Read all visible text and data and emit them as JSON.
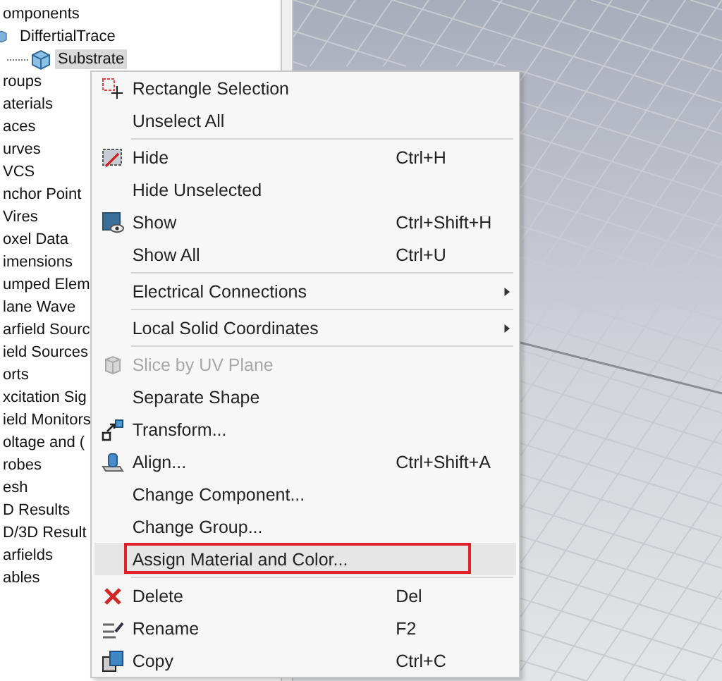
{
  "tree": [
    {
      "label": "omponents",
      "selected": false,
      "children": [
        {
          "label": "DiffertialTrace",
          "selected": false,
          "children": [
            {
              "label": "Substrate",
              "selected": true
            }
          ]
        }
      ]
    },
    {
      "label": "roups",
      "selected": false
    },
    {
      "label": "aterials",
      "selected": false
    },
    {
      "label": "aces",
      "selected": false
    },
    {
      "label": "urves",
      "selected": false
    },
    {
      "label": "VCS",
      "selected": false
    },
    {
      "label": "nchor Point",
      "selected": false
    },
    {
      "label": "Vires",
      "selected": false
    },
    {
      "label": "oxel Data",
      "selected": false
    },
    {
      "label": "imensions",
      "selected": false
    },
    {
      "label": "umped Elem",
      "selected": false
    },
    {
      "label": "lane Wave",
      "selected": false
    },
    {
      "label": "arfield Sourc",
      "selected": false
    },
    {
      "label": "ield Sources",
      "selected": false
    },
    {
      "label": "orts",
      "selected": false
    },
    {
      "label": "xcitation Sig",
      "selected": false
    },
    {
      "label": "ield Monitors",
      "selected": false
    },
    {
      "label": "oltage and (",
      "selected": false
    },
    {
      "label": "robes",
      "selected": false
    },
    {
      "label": "esh",
      "selected": false
    },
    {
      "label": "D Results",
      "selected": false
    },
    {
      "label": "D/3D Result",
      "selected": false
    },
    {
      "label": "arfields",
      "selected": false
    },
    {
      "label": "ables",
      "selected": false
    }
  ],
  "context_menu": {
    "items": [
      {
        "kind": "item",
        "label": "Rectangle Selection",
        "disabled": false,
        "selected": false,
        "outlined": false
      },
      {
        "kind": "item",
        "label": "Unselect All",
        "disabled": false,
        "selected": false,
        "outlined": false
      },
      {
        "kind": "separator"
      },
      {
        "kind": "item",
        "label": "Hide",
        "shortcut": "Ctrl+H",
        "disabled": false,
        "selected": false,
        "outlined": false
      },
      {
        "kind": "item",
        "label": "Hide Unselected",
        "disabled": false,
        "selected": false,
        "outlined": false
      },
      {
        "kind": "item",
        "label": "Show",
        "shortcut": "Ctrl+Shift+H",
        "disabled": false,
        "selected": false,
        "outlined": false
      },
      {
        "kind": "item",
        "label": "Show All",
        "shortcut": "Ctrl+U",
        "disabled": false,
        "selected": false,
        "outlined": false
      },
      {
        "kind": "separator"
      },
      {
        "kind": "item",
        "label": "Electrical Connections",
        "submenu": true,
        "disabled": false,
        "selected": false,
        "outlined": false
      },
      {
        "kind": "separator"
      },
      {
        "kind": "item",
        "label": "Local Solid Coordinates",
        "submenu": true,
        "disabled": false,
        "selected": false,
        "outlined": false
      },
      {
        "kind": "separator"
      },
      {
        "kind": "item",
        "label": "Slice by UV Plane",
        "disabled": true,
        "selected": false,
        "outlined": false
      },
      {
        "kind": "item",
        "label": "Separate Shape",
        "disabled": false,
        "selected": false,
        "outlined": false
      },
      {
        "kind": "item",
        "label": "Transform...",
        "disabled": false,
        "selected": false,
        "outlined": false
      },
      {
        "kind": "item",
        "label": "Align...",
        "shortcut": "Ctrl+Shift+A",
        "disabled": false,
        "selected": false,
        "outlined": false
      },
      {
        "kind": "item",
        "label": "Change Component...",
        "disabled": false,
        "selected": false,
        "outlined": false
      },
      {
        "kind": "item",
        "label": "Change Group...",
        "disabled": false,
        "selected": false,
        "outlined": false
      },
      {
        "kind": "item",
        "label": "Assign Material and Color...",
        "disabled": false,
        "selected": true,
        "outlined": true
      },
      {
        "kind": "separator"
      },
      {
        "kind": "item",
        "label": "Delete",
        "shortcut": "Del",
        "disabled": false,
        "selected": false,
        "outlined": false
      },
      {
        "kind": "item",
        "label": "Rename",
        "shortcut": "F2",
        "disabled": false,
        "selected": false,
        "outlined": false
      },
      {
        "kind": "item",
        "label": "Copy",
        "shortcut": "Ctrl+C",
        "disabled": false,
        "selected": false,
        "outlined": false
      }
    ]
  }
}
